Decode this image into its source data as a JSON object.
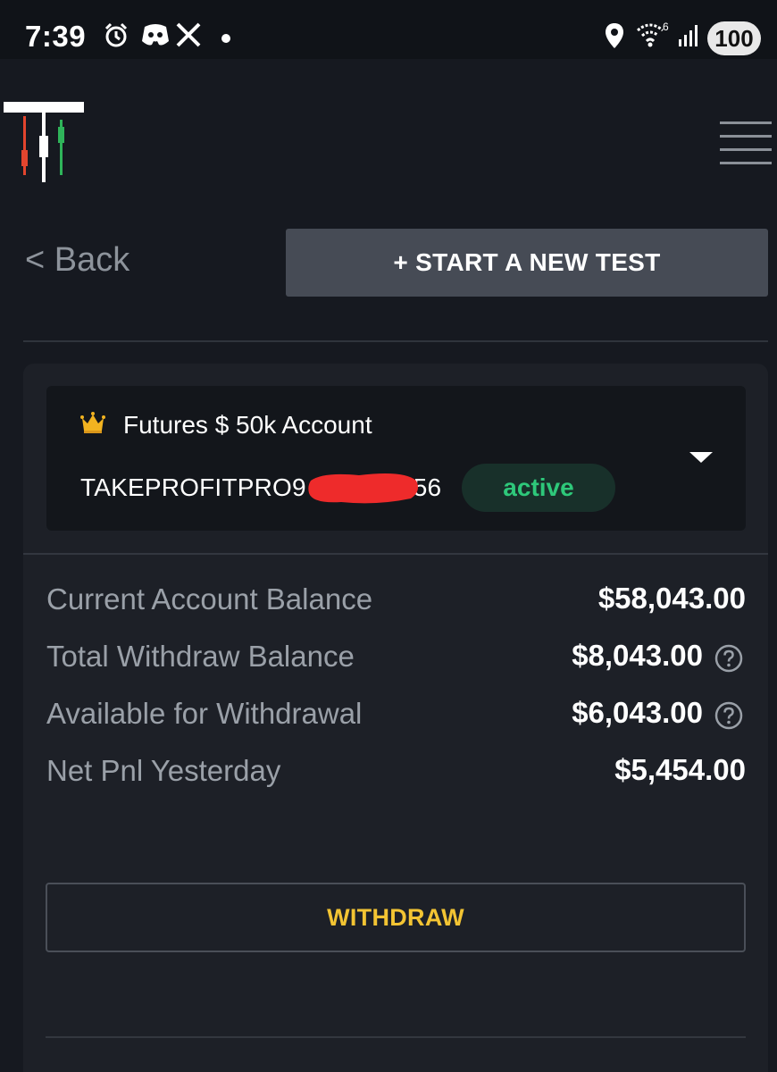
{
  "status_bar": {
    "time": "7:39",
    "icons": [
      "alarm-icon",
      "discord-icon",
      "x-icon",
      "dot-icon",
      "location-icon",
      "wifi-icon",
      "signal-icon"
    ],
    "wifi_label": "6",
    "battery": "100"
  },
  "header": {
    "logo": "brand-logo",
    "menu_icon": "hamburger-menu-icon"
  },
  "nav": {
    "back_label": "< Back",
    "start_test_label": "+ START A NEW TEST"
  },
  "account": {
    "name": "Futures $ 50k Account",
    "id_prefix": "TAKEPROFITPRO9",
    "id_suffix": "56",
    "status": "active",
    "icon": "crown-icon",
    "dropdown_icon": "caret-down-icon"
  },
  "stats": [
    {
      "label": "Current Account Balance",
      "value": "$58,043.00",
      "help": false
    },
    {
      "label": "Total Withdraw Balance",
      "value": "$8,043.00",
      "help": true
    },
    {
      "label": "Available for Withdrawal",
      "value": "$6,043.00",
      "help": true
    },
    {
      "label": "Net Pnl Yesterday",
      "value": "$5,454.00",
      "help": false
    }
  ],
  "actions": {
    "withdraw_label": "WITHDRAW"
  },
  "colors": {
    "background": "#161920",
    "card": "#1d2027",
    "accent_yellow": "#f3c433",
    "active_green": "#2ec87a",
    "button_gray": "#464b55"
  }
}
